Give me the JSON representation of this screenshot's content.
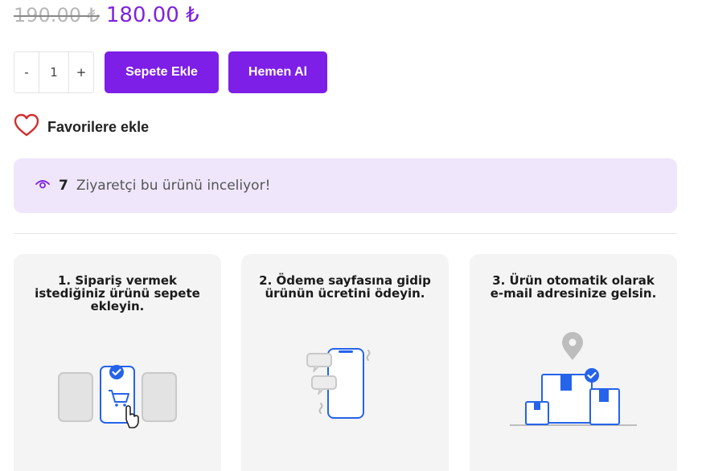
{
  "price": {
    "old": "190.00 ₺",
    "new": "180.00 ₺"
  },
  "quantity": {
    "minus": "-",
    "value": "1",
    "plus": "+"
  },
  "buttons": {
    "add_to_cart": "Sepete Ekle",
    "buy_now": "Hemen Al"
  },
  "favorite": {
    "label": "Favorilere ekle",
    "icon": "heart-icon"
  },
  "viewers": {
    "icon": "eye-icon",
    "count": "7",
    "text": "Ziyaretçi bu ürünü inceliyor!"
  },
  "steps": [
    {
      "title": "1. Sipariş vermek istediğiniz ürünü sepete ekleyin.",
      "icon": "cart-phone-illustration"
    },
    {
      "title": "2. Ödeme sayfasına gidip ürünün ücretini ödeyin.",
      "icon": "phone-chat-illustration"
    },
    {
      "title": "3. Ürün otomatik olarak e-mail adresinize gelsin.",
      "icon": "delivery-boxes-illustration"
    }
  ],
  "colors": {
    "accent": "#7d1fe6",
    "price": "#7d24e0",
    "viewers_bg": "#efe6fb",
    "illustration_blue": "#2563eb",
    "heart": "#d32f2f"
  }
}
